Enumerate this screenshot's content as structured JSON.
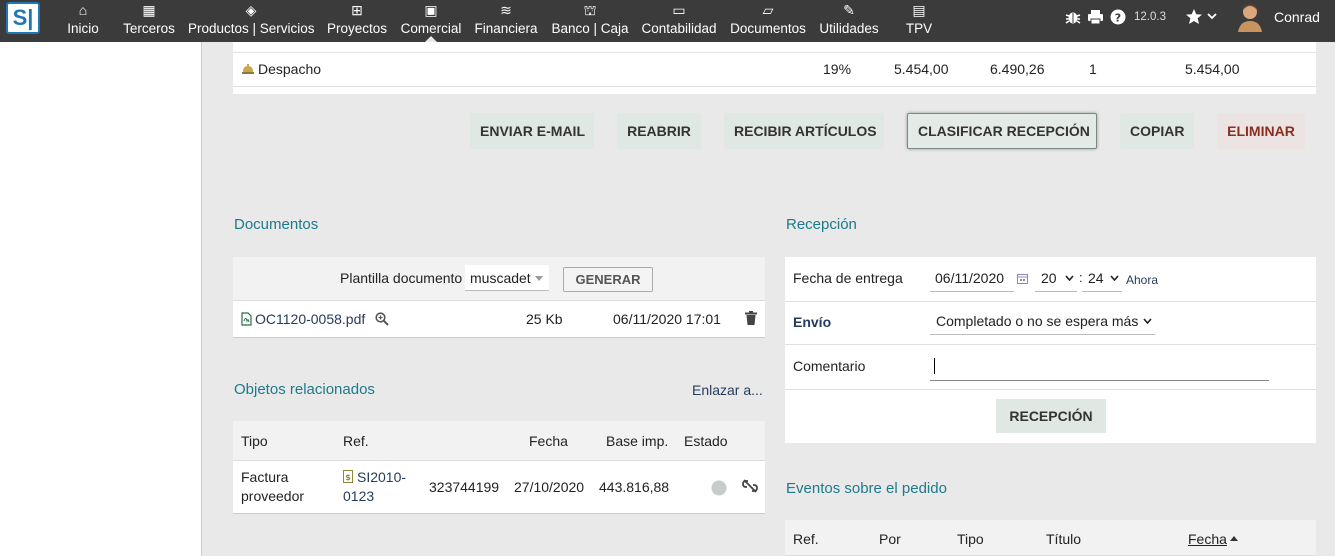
{
  "topbar": {
    "logo": "S|",
    "nav": [
      {
        "label": "Inicio",
        "icon": "home-icon",
        "glyph": "⌂"
      },
      {
        "label": "Terceros",
        "icon": "building-icon",
        "glyph": "▦"
      },
      {
        "label": "Productos | Servicios",
        "icon": "cube-icon",
        "glyph": "◈"
      },
      {
        "label": "Proyectos",
        "icon": "sitemap-icon",
        "glyph": "⊞"
      },
      {
        "label": "Comercial",
        "icon": "suitcase-icon",
        "glyph": "▣"
      },
      {
        "label": "Financiera",
        "icon": "coins-icon",
        "glyph": "≋"
      },
      {
        "label": "Banco | Caja",
        "icon": "bank-icon",
        "glyph": "⛫"
      },
      {
        "label": "Contabilidad",
        "icon": "money-check-icon",
        "glyph": "▭"
      },
      {
        "label": "Documentos",
        "icon": "folder-open-icon",
        "glyph": "▱"
      },
      {
        "label": "Utilidades",
        "icon": "wrench-icon",
        "glyph": "✎"
      },
      {
        "label": "TPV",
        "icon": "cash-register-icon",
        "glyph": "▤"
      }
    ],
    "version": "12.0.3",
    "username": "Conrad"
  },
  "line": {
    "label": "Despacho",
    "vat": "19%",
    "price_ht": "5.454,00",
    "price_ttc": "6.490,26",
    "qty": "1",
    "total": "5.454,00"
  },
  "actions": {
    "send_email": "ENVIAR E-MAIL",
    "reopen": "REABRIR",
    "receive": "RECIBIR ARTÍCULOS",
    "classify": "CLASIFICAR RECEPCIÓN",
    "copy": "COPIAR",
    "delete": "ELIMINAR"
  },
  "documents": {
    "title": "Documentos",
    "template_label": "Plantilla documento",
    "template_value": "muscadet",
    "generate": "GENERAR",
    "file_name": "OC1120-0058.pdf",
    "file_size": "25 Kb",
    "file_date": "06/11/2020 17:01"
  },
  "related": {
    "title": "Objetos relacionados",
    "link": "Enlazar a...",
    "columns": {
      "type": "Tipo",
      "ref": "Ref.",
      "date": "Fecha",
      "base": "Base imp.",
      "status": "Estado"
    },
    "row": {
      "type_line1": "Factura",
      "type_line2": "proveedor",
      "ref_line1": "SI2010-",
      "ref_line2": "0123",
      "ref_supplier": "323744199",
      "date": "27/10/2020",
      "base": "443.816,88"
    }
  },
  "reception": {
    "title": "Recepción",
    "delivery_label": "Fecha de entrega",
    "delivery_date": "06/11/2020",
    "hour": "20",
    "minute": "24",
    "now": "Ahora",
    "shipping_label": "Envío",
    "shipping_value": "Completado o no se espera más",
    "comment_label": "Comentario",
    "submit": "RECEPCIÓN"
  },
  "events": {
    "title": "Eventos sobre el pedido",
    "columns": {
      "ref": "Ref.",
      "by": "Por",
      "type": "Tipo",
      "title": "Título",
      "date": "Fecha"
    }
  }
}
